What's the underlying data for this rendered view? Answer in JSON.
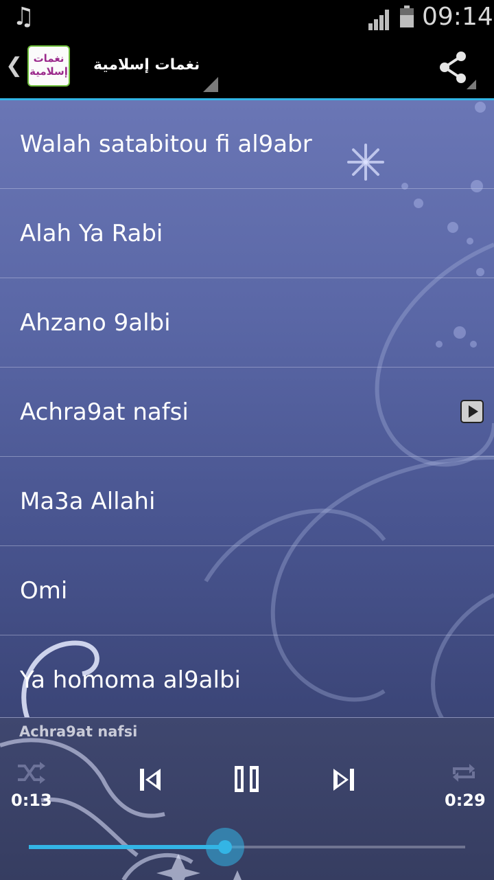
{
  "status_bar": {
    "time": "09:14",
    "notification_icon": "music-note-icon"
  },
  "action_bar": {
    "app_icon_text_line1": "نغمات",
    "app_icon_text_line2": "إسلامية",
    "title": "نغمات إسلامية",
    "share_icon": "share-icon",
    "accent_color": "#33b5e5"
  },
  "songs": [
    {
      "title": "Walah satabitou fi al9abr"
    },
    {
      "title": "Alah Ya Rabi"
    },
    {
      "title": "Ahzano 9albi"
    },
    {
      "title": "Achra9at nafsi",
      "playing": true
    },
    {
      "title": "Ma3a Allahi"
    },
    {
      "title": "Omi"
    },
    {
      "title": "Ya homoma al9albi"
    }
  ],
  "player": {
    "now_playing": "Achra9at nafsi",
    "elapsed": "0:13",
    "duration": "0:29",
    "progress_fraction": 0.45
  }
}
